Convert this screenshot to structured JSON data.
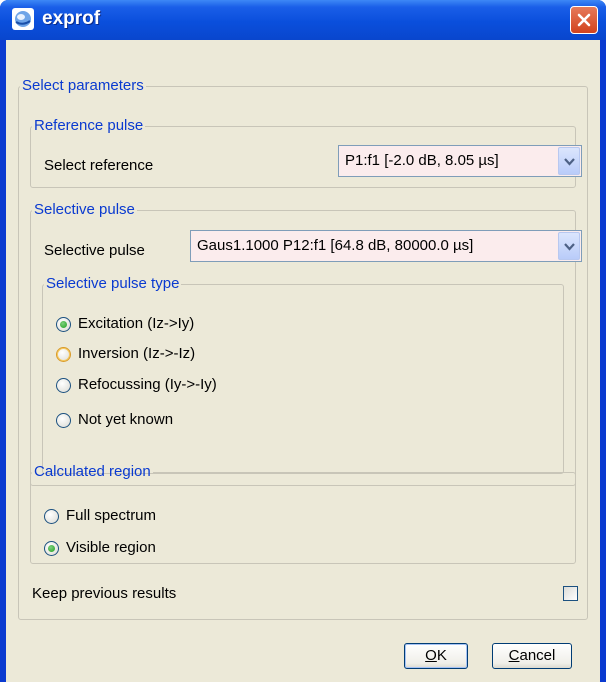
{
  "window": {
    "title": "exprof",
    "close_icon": "close-icon",
    "app_icon": "exprof-app-icon"
  },
  "select_parameters": {
    "legend": "Select parameters",
    "reference_pulse": {
      "legend": "Reference pulse",
      "label": "Select reference",
      "value": "P1:f1 [-2.0 dB, 8.05 µs]"
    },
    "selective_pulse": {
      "legend": "Selective pulse",
      "label": "Selective pulse",
      "value": "Gaus1.1000  P12:f1 [64.8 dB, 80000.0 µs]",
      "type": {
        "legend": "Selective pulse type",
        "options": [
          {
            "label": "Excitation (Iz->Iy)",
            "selected": true
          },
          {
            "label": "Inversion (Iz->-Iz)",
            "selected": false
          },
          {
            "label": "Refocussing (Iy->-Iy)",
            "selected": false
          },
          {
            "label": "Not yet known",
            "selected": false
          }
        ]
      }
    },
    "calculated_region": {
      "legend": "Calculated region",
      "options": [
        {
          "label": "Full spectrum",
          "selected": false
        },
        {
          "label": "Visible region",
          "selected": true
        }
      ]
    }
  },
  "keep_previous": {
    "label": "Keep previous results",
    "checked": false
  },
  "buttons": {
    "ok": {
      "mnemonic": "O",
      "rest": "K"
    },
    "cancel": {
      "mnemonic": "C",
      "rest": "ancel"
    }
  },
  "colors": {
    "title_bar": "#0a4fdc",
    "legend_text": "#0a3ad0",
    "dialog_bg": "#ece9d8",
    "combo_bg": "#fbeced"
  }
}
